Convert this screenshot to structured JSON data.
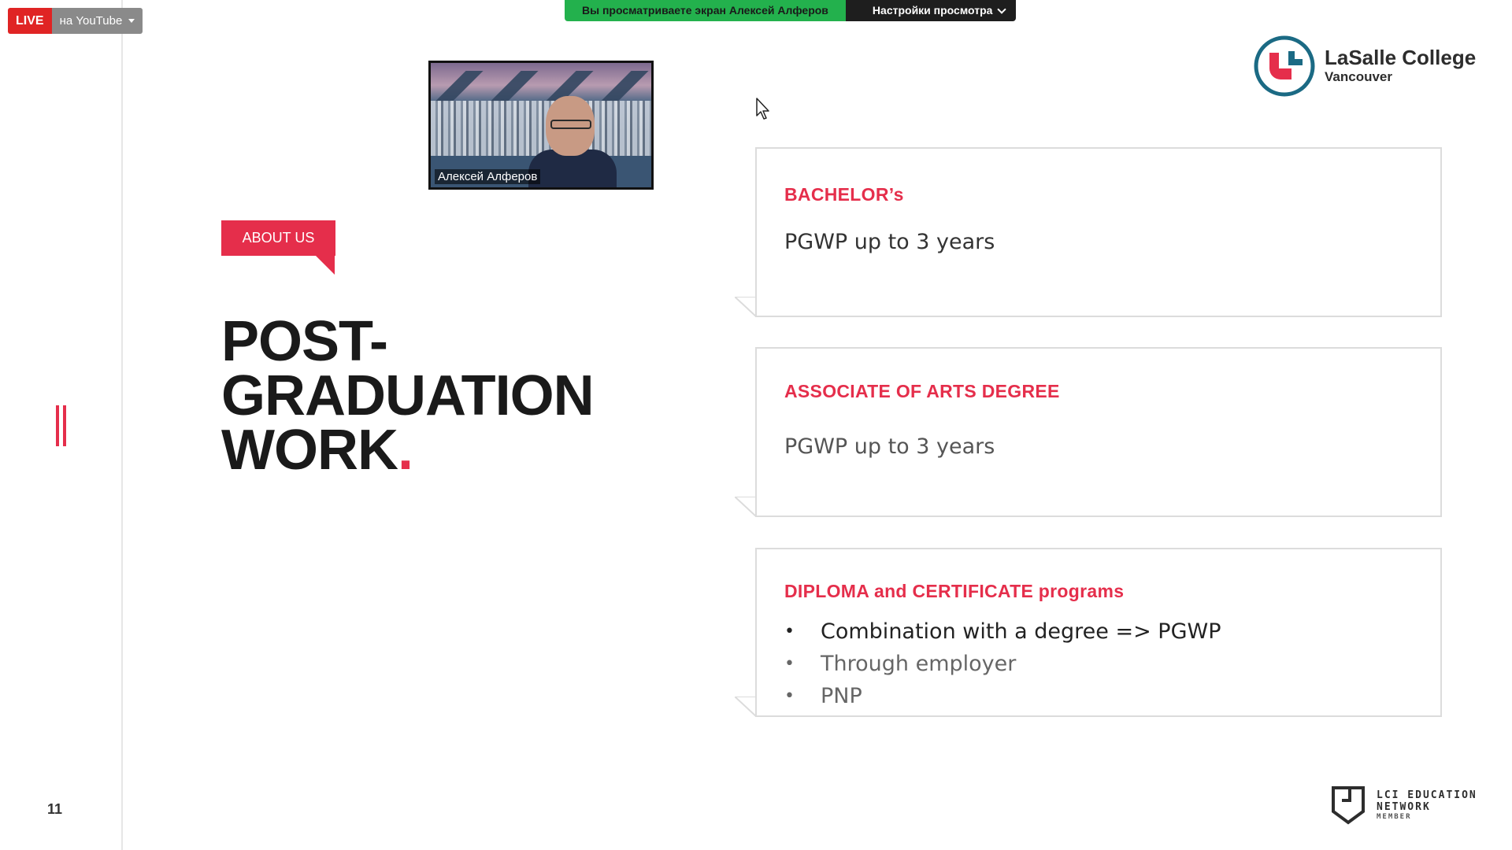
{
  "live": {
    "badge": "LIVE",
    "target": "на YouTube"
  },
  "share_bar": {
    "status": "Вы просматриваете экран Алексей Алферов",
    "settings": "Настройки просмотра"
  },
  "video": {
    "participant_name": "Алексей Алферов"
  },
  "slide": {
    "tag": "ABOUT US",
    "headline": {
      "line1": "POST-",
      "line2": "GRADUATION",
      "line3": "WORK",
      "dot": "."
    },
    "number": "11",
    "cards": [
      {
        "title": "BACHELOR’s",
        "body": "PGWP up to 3 years"
      },
      {
        "title": "ASSOCIATE OF ARTS DEGREE",
        "body": "PGWP up to 3 years"
      },
      {
        "title": "DIPLOMA and CERTIFICATE programs",
        "bullets": [
          "Combination with a degree => PGWP",
          "Through employer",
          "PNP"
        ]
      }
    ]
  },
  "logo": {
    "name": "LaSalle College",
    "city": "Vancouver"
  },
  "lci": {
    "line1": "LCI EDUCATION",
    "line2": "NETWORK",
    "member": "MEMBER"
  },
  "colors": {
    "accent": "#e52e4b",
    "share_green": "#23b14d",
    "live_red": "#e02424"
  },
  "icons": {
    "caret": "caret-down-icon",
    "chevron": "chevron-down-icon",
    "cursor": "mouse-pointer-icon"
  }
}
